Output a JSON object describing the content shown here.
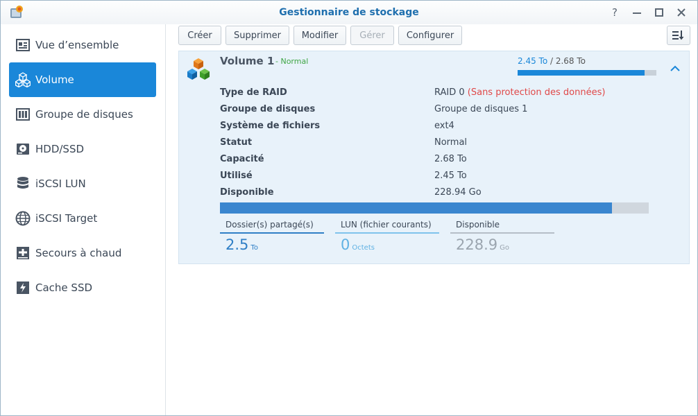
{
  "window": {
    "title": "Gestionnaire de stockage",
    "help_glyph": "?",
    "accent": "#1a87d9"
  },
  "sidebar": {
    "items": [
      {
        "label": "Vue d’ensemble",
        "icon": "overview-icon"
      },
      {
        "label": "Volume",
        "icon": "volume-cubes-icon",
        "active": true
      },
      {
        "label": "Groupe de disques",
        "icon": "disk-group-icon"
      },
      {
        "label": "HDD/SSD",
        "icon": "hdd-icon"
      },
      {
        "label": "iSCSI LUN",
        "icon": "database-icon"
      },
      {
        "label": "iSCSI Target",
        "icon": "globe-icon"
      },
      {
        "label": "Secours à chaud",
        "icon": "hot-spare-icon"
      },
      {
        "label": "Cache SSD",
        "icon": "ssd-cache-icon"
      }
    ]
  },
  "toolbar": {
    "create": "Créer",
    "delete": "Supprimer",
    "modify": "Modifier",
    "manage": "Gérer",
    "configure": "Configurer"
  },
  "volume": {
    "name": "Volume 1",
    "status_sep": " - ",
    "status": "Normal",
    "usage_used": "2.45 To",
    "usage_total": " / 2.68 To",
    "usage_fraction": 0.914,
    "details": [
      {
        "key": "Type de RAID",
        "value": "RAID 0 ",
        "note": "(Sans protection des données)"
      },
      {
        "key": "Groupe de disques",
        "value": "Groupe de disques 1"
      },
      {
        "key": "Système de fichiers",
        "value": "ext4"
      },
      {
        "key": "Statut",
        "value": "Normal"
      },
      {
        "key": "Capacité",
        "value": "2.68 To"
      },
      {
        "key": "Utilisé",
        "value": "2.45 To"
      },
      {
        "key": "Disponible",
        "value": "228.94 Go"
      }
    ],
    "stats": [
      {
        "label": "Dossier(s) partagé(s)",
        "value": "2.5",
        "unit": "To"
      },
      {
        "label": "LUN (fichier courants)",
        "value": "0",
        "unit": "Octets"
      },
      {
        "label": "Disponible",
        "value": "228.9",
        "unit": "Go"
      }
    ]
  }
}
